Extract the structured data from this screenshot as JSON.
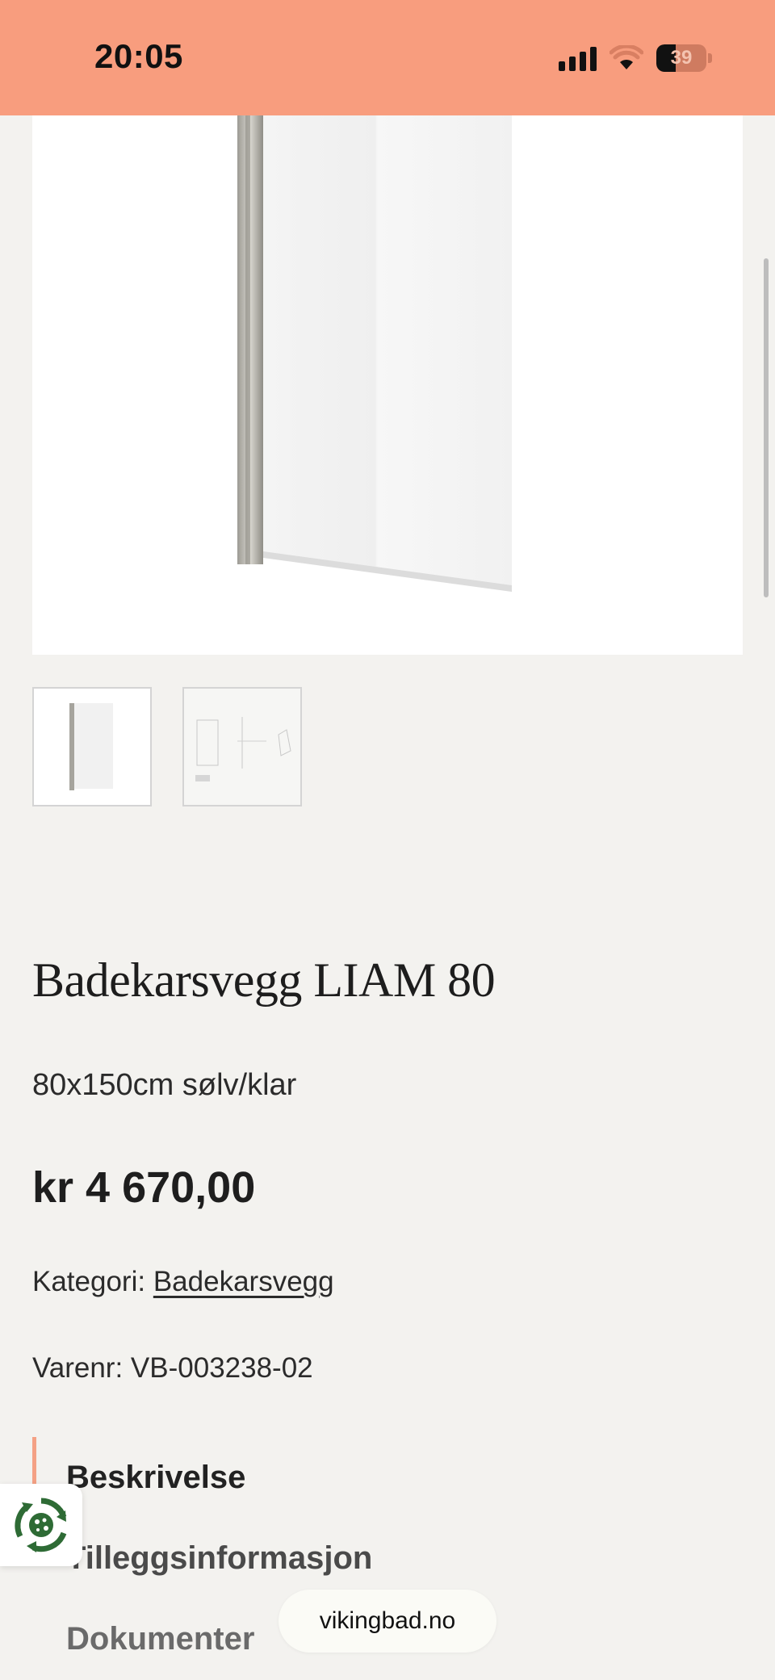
{
  "status_bar": {
    "time": "20:05",
    "battery_level": "39",
    "signal_icon": "signal-bars-icon",
    "wifi_icon": "wifi-icon",
    "battery_icon": "battery-icon"
  },
  "product": {
    "title": "Badekarsvegg LIAM 80",
    "subtitle": "80x150cm sølv/klar",
    "price": "kr 4 670,00",
    "category_label": "Kategori:",
    "category_value": "Badekarsvegg",
    "sku_label": "Varenr:",
    "sku_value": "VB-003238-02",
    "thumbnails": [
      "product-photo-thumbnail",
      "technical-drawing-thumbnail"
    ]
  },
  "tabs": [
    {
      "label": "Beskrivelse",
      "active": true
    },
    {
      "label": "Tilleggsinformasjon",
      "active": false
    },
    {
      "label": "Dokumenter",
      "active": false
    }
  ],
  "browser": {
    "url": "vikingbad.no"
  },
  "colors": {
    "status_bar": "#f89d7e",
    "page_background": "#f3f2ef",
    "active_tab_accent": "#f4a185",
    "cookie_icon": "#2e6b35"
  }
}
